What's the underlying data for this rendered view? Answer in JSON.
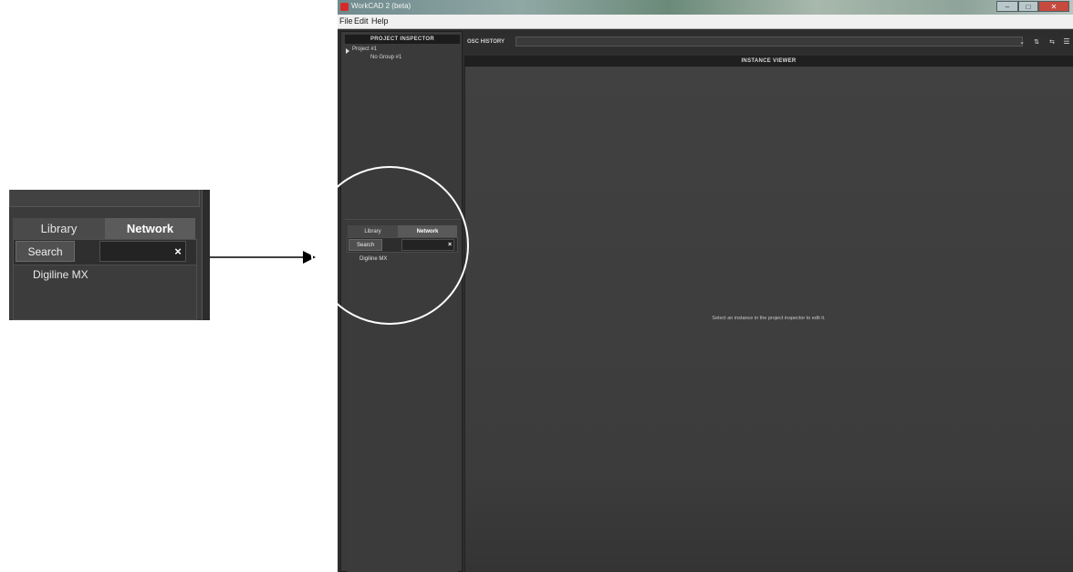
{
  "window": {
    "title": "WorkCAD 2 (beta)",
    "controls": {
      "minimize": "–",
      "maximize": "□",
      "close": "✕"
    }
  },
  "menu": {
    "file": "File",
    "edit": "Edit",
    "help": "Help"
  },
  "project_inspector": {
    "header": "PROJECT INSPECTOR",
    "tree": {
      "project": "Project #1",
      "group": "No Group #1"
    }
  },
  "library_panel": {
    "tabs": {
      "library": "Library",
      "network": "Network"
    },
    "active_tab": "Network",
    "search_label": "Search",
    "search_value": "",
    "clear_icon": "×",
    "items": [
      "Digiline MX"
    ]
  },
  "osc_history": {
    "label": "OSC HISTORY",
    "chevron": "⌄",
    "icon_1": "⇅",
    "icon_2": "⇆",
    "menu_icon": "☰"
  },
  "instance_viewer": {
    "header": "INSTANCE VIEWER",
    "empty_message": "Select an instance in the project inspector to edit it."
  },
  "colors": {
    "panel_bg": "#3a3a3a",
    "header_bg": "#1c1c1c",
    "active_tab": "#595959",
    "viewer_bg": "#414141"
  }
}
